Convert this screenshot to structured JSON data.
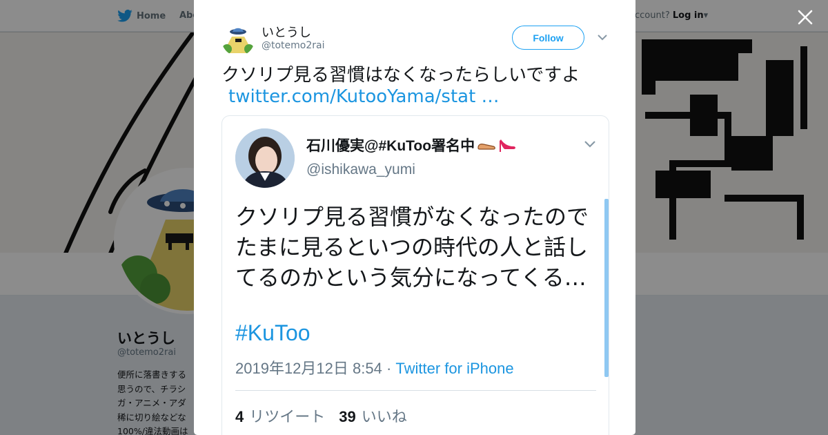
{
  "background": {
    "nav": {
      "home_label": "Home",
      "about_label": "Abo",
      "account_prompt": "ccount?",
      "login_label": "Log in"
    },
    "profile": {
      "name": "いとうし",
      "handle": "@totemo2rai",
      "bio_lines": [
        "便所に落書きする",
        "思うので、チラシ",
        "ガ・アニメ・アダ",
        "稀に切り絵などな",
        "100%/違法動画は"
      ]
    }
  },
  "tweet": {
    "author_name": "いとうし",
    "author_handle": "@totemo2rai",
    "follow_label": "Follow",
    "text": "クソリプ見る習慣はなくなったらしいですよ",
    "link": "twitter.com/KutooYama/stat …",
    "quote": {
      "author_name": "石川優実@#KuToo署名中",
      "author_handle": "@ishikawa_yumi",
      "text": "クソリプ見る習慣がなくなったのでたまに見るといつの時代の人と話してるのかという気分になってくる…",
      "hashtag": "#KuToo",
      "date": "2019年12月12日 8:54",
      "separator": " · ",
      "source": "Twitter for iPhone",
      "retweets_count": "4",
      "retweets_label": "リツイート",
      "likes_count": "39",
      "likes_label": "いいね"
    }
  },
  "icons": {
    "close": "close-icon",
    "twitter_bird": "twitter-bird-icon",
    "caret": "chevron-down-icon"
  },
  "colors": {
    "accent": "#1da1f2",
    "link": "#1b95e0",
    "text": "#14171a",
    "muted": "#657786"
  }
}
